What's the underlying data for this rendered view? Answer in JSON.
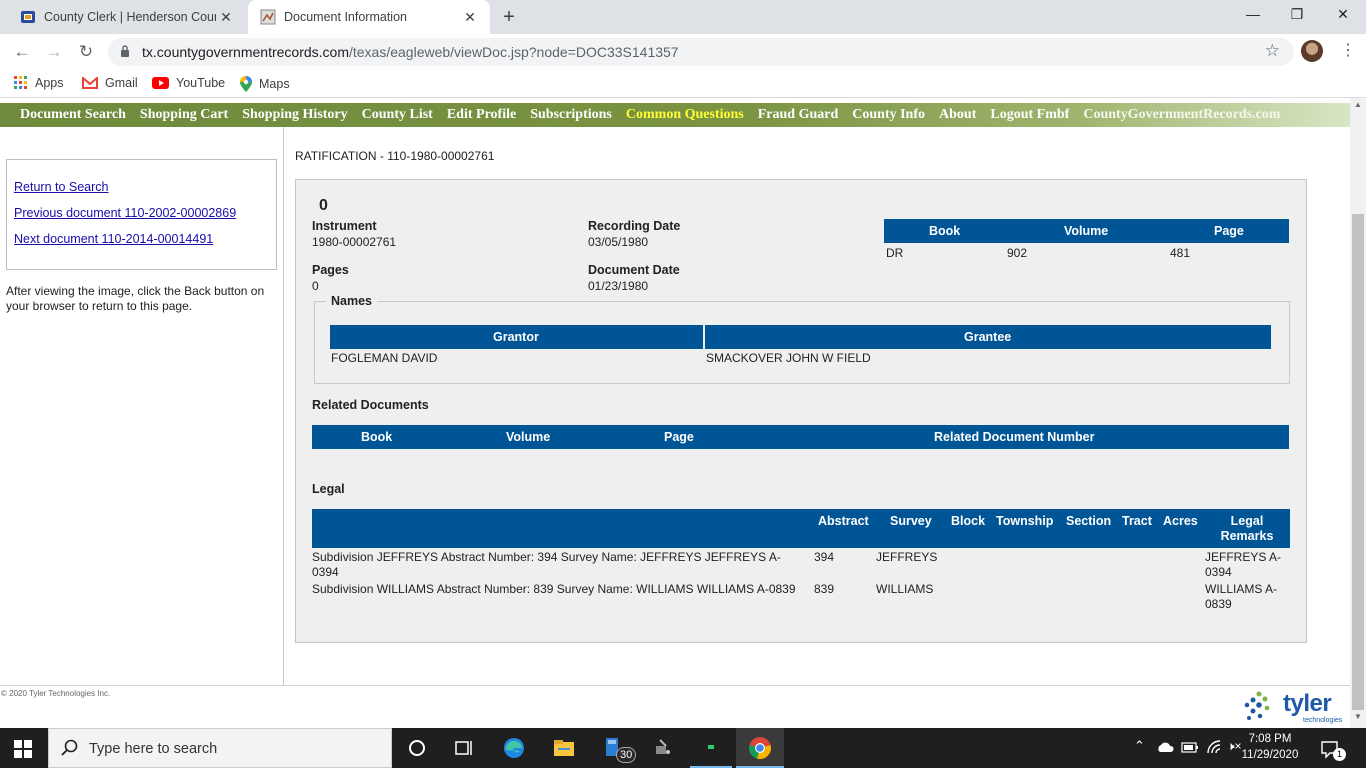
{
  "browser": {
    "tabs": [
      {
        "title": "County Clerk | Henderson County, Te",
        "active": false
      },
      {
        "title": "Document Information",
        "active": true
      }
    ],
    "url_host": "tx.countygovernmentrecords.com",
    "url_path": "/texas/eagleweb/viewDoc.jsp?node=DOC33S141357",
    "bookmarks": [
      {
        "label": "Apps",
        "icon": "apps-grid-icon"
      },
      {
        "label": "Gmail",
        "icon": "gmail-icon"
      },
      {
        "label": "YouTube",
        "icon": "youtube-icon"
      },
      {
        "label": "Maps",
        "icon": "maps-pin-icon"
      }
    ]
  },
  "site_nav": [
    {
      "label": "Document Search"
    },
    {
      "label": "Shopping Cart"
    },
    {
      "label": "Shopping History"
    },
    {
      "label": "County List"
    },
    {
      "label": "Edit Profile"
    },
    {
      "label": "Subscriptions"
    },
    {
      "label": "Common Questions",
      "highlight": true
    },
    {
      "label": "Fraud Guard"
    },
    {
      "label": "County Info"
    },
    {
      "label": "About"
    },
    {
      "label": "Logout Fmbf"
    },
    {
      "label": "CountyGovernmentRecords.com"
    }
  ],
  "sidebar": {
    "return_link": "Return to Search",
    "prev_link": "Previous document 110-2002-00002869",
    "next_link": "Next document 110-2014-00014491",
    "hint": "After viewing the image, click the Back button on your browser to return to this page."
  },
  "document": {
    "title": "RATIFICATION - 110-1980-00002761",
    "count": "0",
    "instrument_label": "Instrument",
    "instrument": "1980-00002761",
    "recording_date_label": "Recording Date",
    "recording_date": "03/05/1980",
    "pages_label": "Pages",
    "pages": "0",
    "document_date_label": "Document Date",
    "document_date": "01/23/1980",
    "bvp_headers": [
      "Book",
      "Volume",
      "Page"
    ],
    "bvp_row": [
      "DR",
      "902",
      "481"
    ],
    "names_legend": "Names",
    "names_headers": [
      "Grantor",
      "Grantee"
    ],
    "grantor": "FOGLEMAN DAVID",
    "grantee": "SMACKOVER JOHN W FIELD",
    "related_title": "Related Documents",
    "related_headers": [
      "Book",
      "Volume",
      "Page",
      "Related Document Number"
    ],
    "legal_title": "Legal",
    "legal_headers": [
      "Abstract",
      "Survey",
      "Block",
      "Township",
      "Section",
      "Tract",
      "Acres",
      "Legal\nRemarks"
    ],
    "legal_rows": [
      {
        "desc": "Subdivision JEFFREYS Abstract Number: 394 Survey Name: JEFFREYS JEFFREYS A-0394",
        "abstract": "394",
        "survey": "JEFFREYS",
        "remarks": "JEFFREYS A-0394"
      },
      {
        "desc": "Subdivision WILLIAMS Abstract Number: 839 Survey Name: WILLIAMS WILLIAMS A-0839",
        "abstract": "839",
        "survey": "WILLIAMS",
        "remarks": "WILLIAMS A-0839"
      }
    ]
  },
  "footer": {
    "copyright": "© 2020 Tyler Technologies Inc.",
    "logo_word": "tyler",
    "logo_sub": "technologies"
  },
  "taskbar": {
    "search_placeholder": "Type here to search",
    "badge": "30",
    "time": "7:08 PM",
    "date": "11/29/2020",
    "notification_count": "1"
  },
  "colors": {
    "table_header": "#005596",
    "nav_green": "#7a9443",
    "nav_active": "#ffff33",
    "panel_bg": "#efefef"
  }
}
